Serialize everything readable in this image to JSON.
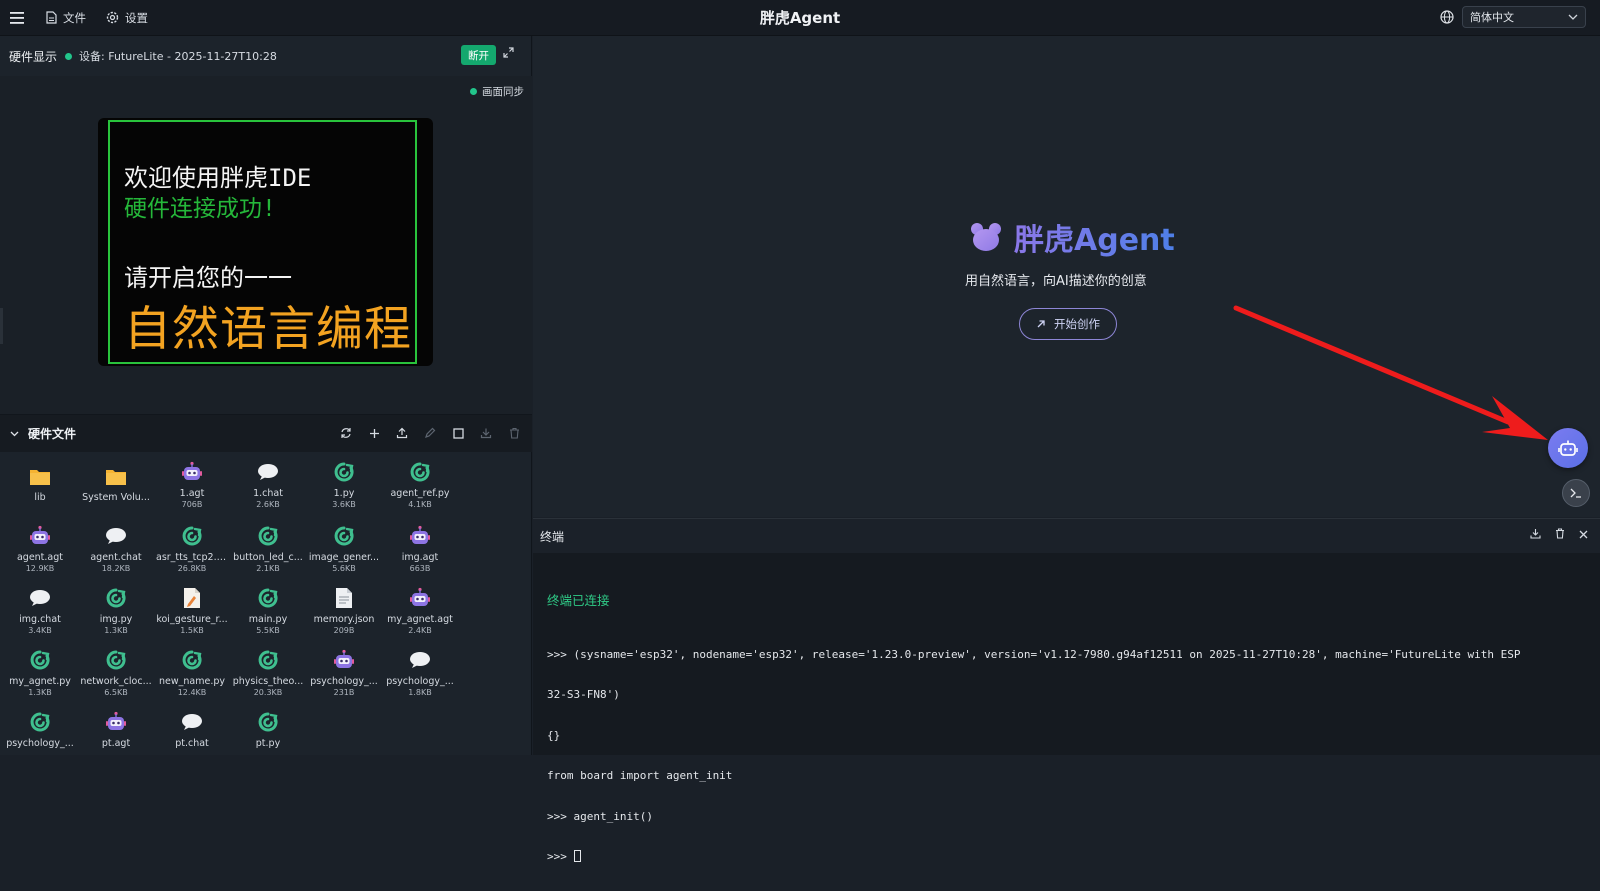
{
  "topbar": {
    "menu_icon": "hamburger-icon",
    "file_label": "文件",
    "settings_label": "设置",
    "app_title": "胖虎Agent",
    "language": "简体中文"
  },
  "hardware": {
    "title": "硬件显示",
    "device": "设备: FutureLite - 2025-11-27T10:28",
    "disconnect": "断开",
    "sync_label": "画面同步",
    "screen": {
      "line1": "欢迎使用胖虎IDE",
      "line2": "硬件连接成功!",
      "line3": "请开启您的一一",
      "line4": "自然语言编程"
    }
  },
  "files": {
    "title": "硬件文件",
    "items": [
      {
        "name": "lib",
        "size": "",
        "type": "folder"
      },
      {
        "name": "System Volu...",
        "size": "",
        "type": "folder"
      },
      {
        "name": "1.agt",
        "size": "706B",
        "type": "agt"
      },
      {
        "name": "1.chat",
        "size": "2.6KB",
        "type": "chat"
      },
      {
        "name": "1.py",
        "size": "3.6KB",
        "type": "py"
      },
      {
        "name": "agent_ref.py",
        "size": "4.1KB",
        "type": "py"
      },
      {
        "name": "agent.agt",
        "size": "12.9KB",
        "type": "agt"
      },
      {
        "name": "agent.chat",
        "size": "18.2KB",
        "type": "chat"
      },
      {
        "name": "asr_tts_tcp2.py",
        "size": "26.8KB",
        "type": "py"
      },
      {
        "name": "button_led_c...",
        "size": "2.1KB",
        "type": "py"
      },
      {
        "name": "image_gener...",
        "size": "5.6KB",
        "type": "py"
      },
      {
        "name": "img.agt",
        "size": "663B",
        "type": "agt"
      },
      {
        "name": "img.chat",
        "size": "3.4KB",
        "type": "chat"
      },
      {
        "name": "img.py",
        "size": "1.3KB",
        "type": "py"
      },
      {
        "name": "koi_gesture_r...",
        "size": "1.5KB",
        "type": "doc"
      },
      {
        "name": "main.py",
        "size": "5.5KB",
        "type": "py"
      },
      {
        "name": "memory.json",
        "size": "209B",
        "type": "json"
      },
      {
        "name": "my_agnet.agt",
        "size": "2.4KB",
        "type": "agt"
      },
      {
        "name": "my_agnet.py",
        "size": "1.3KB",
        "type": "py"
      },
      {
        "name": "network_cloc...",
        "size": "6.5KB",
        "type": "py"
      },
      {
        "name": "new_name.py",
        "size": "12.4KB",
        "type": "py"
      },
      {
        "name": "physics_theo...",
        "size": "20.3KB",
        "type": "py"
      },
      {
        "name": "psychology_...",
        "size": "231B",
        "type": "agt"
      },
      {
        "name": "psychology_...",
        "size": "1.8KB",
        "type": "chat"
      },
      {
        "name": "psychology_...",
        "size": "",
        "type": "py"
      },
      {
        "name": "pt.agt",
        "size": "",
        "type": "agt"
      },
      {
        "name": "pt.chat",
        "size": "",
        "type": "chat"
      },
      {
        "name": "pt.py",
        "size": "",
        "type": "py"
      }
    ]
  },
  "hero": {
    "name": "胖虎Agent",
    "subtitle": "用自然语言，向AI描述你的创意",
    "start_button": "开始创作"
  },
  "terminal": {
    "title": "终端",
    "connected": "终端已连接",
    "lines": [
      ">>> (sysname='esp32', nodename='esp32', release='1.23.0-preview', version='v1.12-7980.g94af12511 on 2025-11-27T10:28', machine='FutureLite with ESP",
      "32-S3-FN8')",
      "{}",
      "from board import agent_init",
      ">>> agent_init()"
    ],
    "prompt": ">>> "
  },
  "colors": {
    "accent_green": "#14a86e",
    "accent_purple": "#7b7cf0",
    "arrow_red": "#ee1c1c"
  }
}
